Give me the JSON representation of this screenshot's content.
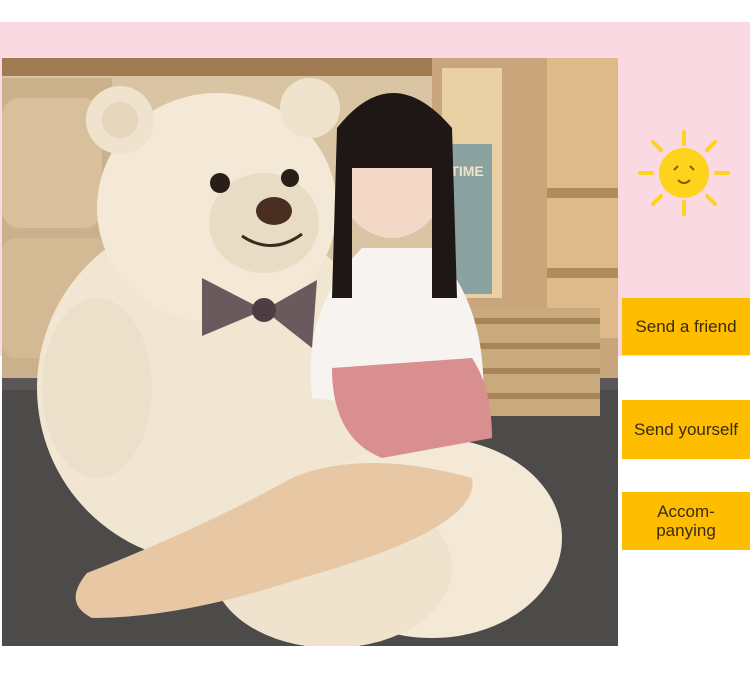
{
  "colors": {
    "pink_background": "#fbd9e3",
    "tag_yellow": "#ffbd00",
    "sun_yellow": "#ffd21c"
  },
  "photo": {
    "subject": "giant cream teddy bear with checkered bow",
    "sign_text": "TIME"
  },
  "tags": [
    {
      "lines": [
        "Send a friend"
      ]
    },
    {
      "lines": [
        "Send yourself"
      ]
    },
    {
      "lines": [
        "Accom-",
        "panying"
      ]
    }
  ],
  "icons": {
    "sun": "sun-icon"
  }
}
